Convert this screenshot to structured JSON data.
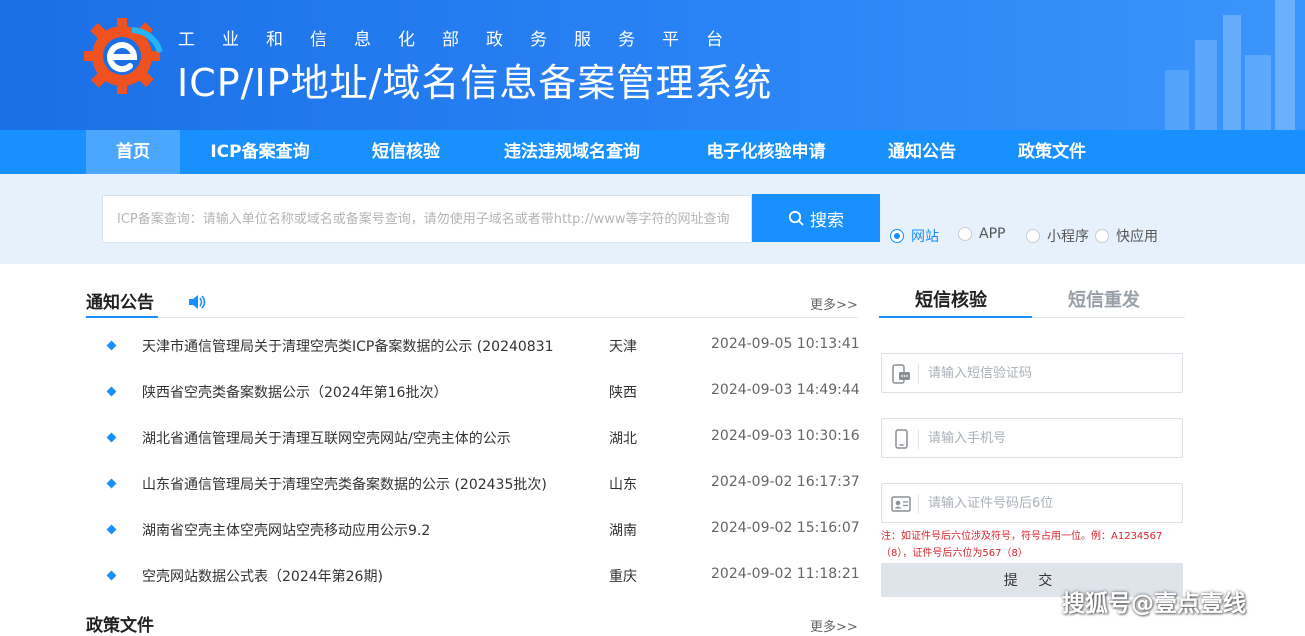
{
  "header": {
    "subtitle": "工业和信息化部政务服务平台",
    "title": "ICP/IP地址/域名信息备案管理系统",
    "logo_icon": "gear-e-logo-icon"
  },
  "nav": {
    "items": [
      "首页",
      "ICP备案查询",
      "短信核验",
      "违法违规域名查询",
      "电子化核验申请",
      "通知公告",
      "政策文件"
    ],
    "active": "首页"
  },
  "search": {
    "placeholder": "ICP备案查询：请输入单位名称或域名或备案号查询，请勿使用子域名或者带http://www等字符的网址查询",
    "button_label": "搜索",
    "button_icon": "search-icon",
    "types": [
      "网站",
      "APP",
      "小程序",
      "快应用"
    ],
    "selected_type": "网站"
  },
  "notices": {
    "title": "通知公告",
    "icon": "speaker-icon",
    "more": "更多>>",
    "items": [
      {
        "title": "天津市通信管理局关于清理空壳类ICP备案数据的公示 (20240831",
        "region": "天津",
        "datetime": "2024-09-05 10:13:41"
      },
      {
        "title": "陕西省空壳类备案数据公示（2024年第16批次）",
        "region": "陕西",
        "datetime": "2024-09-03 14:49:44"
      },
      {
        "title": "湖北省通信管理局关于清理互联网空壳网站/空壳主体的公示",
        "region": "湖北",
        "datetime": "2024-09-03 10:30:16"
      },
      {
        "title": "山东省通信管理局关于清理空壳类备案数据的公示 (202435批次)",
        "region": "山东",
        "datetime": "2024-09-02 16:17:37"
      },
      {
        "title": "湖南省空壳主体空壳网站空壳移动应用公示9.2",
        "region": "湖南",
        "datetime": "2024-09-02 15:16:07"
      },
      {
        "title": "空壳网站数据公式表（2024年第26期)",
        "region": "重庆",
        "datetime": "2024-09-02 11:18:21"
      }
    ]
  },
  "policy": {
    "title": "政策文件",
    "more": "更多>>"
  },
  "sms": {
    "tabs": [
      "短信核验",
      "短信重发"
    ],
    "active_tab": "短信核验",
    "code_placeholder": "请输入短信验证码",
    "phone_placeholder": "请输入手机号",
    "id_placeholder": "请输入证件号码后6位",
    "note_line1": "注：如证件号后六位涉及符号，符号占用一位。例：A1234567",
    "note_line2": "（8），证件号后六位为567（8）",
    "submit_label": "提 交",
    "accent": "#1890ff",
    "note_color": "#d9232e"
  },
  "watermark": "搜狐号@壹点壹线"
}
